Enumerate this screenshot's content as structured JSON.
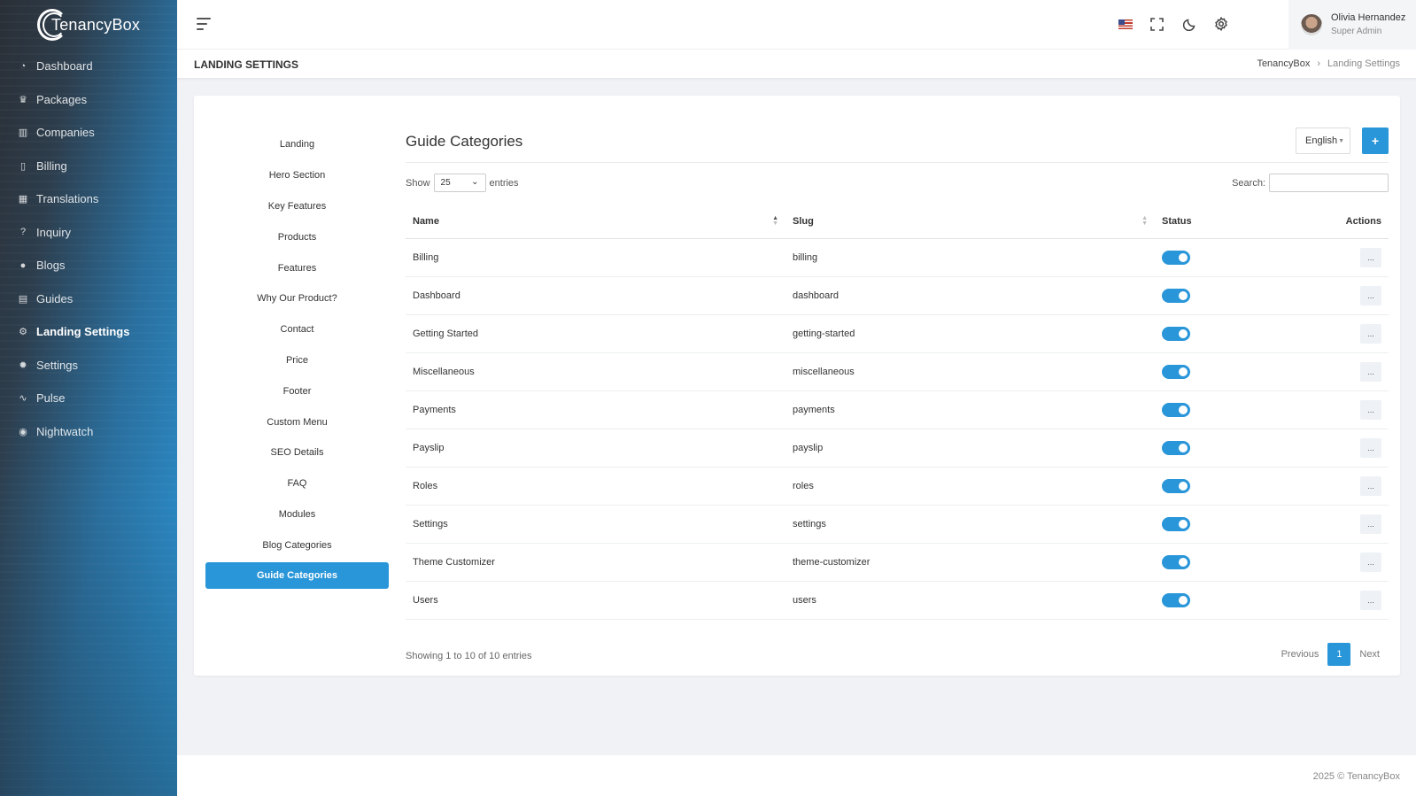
{
  "brand": {
    "name": "TenancyBox"
  },
  "sidebar": {
    "items": [
      {
        "label": "Dashboard",
        "icon": "dashboard-icon",
        "glyph": "◔"
      },
      {
        "label": "Packages",
        "icon": "trophy-icon",
        "glyph": "♛"
      },
      {
        "label": "Companies",
        "icon": "bar-chart-icon",
        "glyph": "▥"
      },
      {
        "label": "Billing",
        "icon": "document-icon",
        "glyph": "▯"
      },
      {
        "label": "Translations",
        "icon": "translate-icon",
        "glyph": "▦"
      },
      {
        "label": "Inquiry",
        "icon": "question-icon",
        "glyph": "?"
      },
      {
        "label": "Blogs",
        "icon": "blog-icon",
        "glyph": "●"
      },
      {
        "label": "Guides",
        "icon": "guide-icon",
        "glyph": "▤"
      },
      {
        "label": "Landing Settings",
        "icon": "gears-icon",
        "glyph": "⚙"
      },
      {
        "label": "Settings",
        "icon": "settings-icon",
        "glyph": "✹"
      },
      {
        "label": "Pulse",
        "icon": "pulse-icon",
        "glyph": "∿"
      },
      {
        "label": "Nightwatch",
        "icon": "eye-icon",
        "glyph": "◉"
      }
    ],
    "active_index": 8
  },
  "topbar": {
    "user_name": "Olivia Hernandez",
    "user_role": "Super Admin"
  },
  "page": {
    "title": "LANDING SETTINGS",
    "breadcrumb": [
      "TenancyBox",
      "Landing Settings"
    ]
  },
  "settings_menu": [
    "Landing",
    "Hero Section",
    "Key Features",
    "Products",
    "Features",
    "Why Our Product?",
    "Contact",
    "Price",
    "Footer",
    "Custom Menu",
    "SEO Details",
    "FAQ",
    "Modules",
    "Blog Categories",
    "Guide Categories"
  ],
  "settings_menu_active": "Guide Categories",
  "content": {
    "title": "Guide Categories",
    "language": "English",
    "add_label": "+",
    "show_label": "Show",
    "entries_value": "25",
    "entries_label": "entries",
    "search_label": "Search:",
    "search_value": ""
  },
  "table": {
    "columns": [
      "Name",
      "Slug",
      "Status",
      "Actions"
    ],
    "rows": [
      {
        "name": "Billing",
        "slug": "billing",
        "status": true
      },
      {
        "name": "Dashboard",
        "slug": "dashboard",
        "status": true
      },
      {
        "name": "Getting Started",
        "slug": "getting-started",
        "status": true
      },
      {
        "name": "Miscellaneous",
        "slug": "miscellaneous",
        "status": true
      },
      {
        "name": "Payments",
        "slug": "payments",
        "status": true
      },
      {
        "name": "Payslip",
        "slug": "payslip",
        "status": true
      },
      {
        "name": "Roles",
        "slug": "roles",
        "status": true
      },
      {
        "name": "Settings",
        "slug": "settings",
        "status": true
      },
      {
        "name": "Theme Customizer",
        "slug": "theme-customizer",
        "status": true
      },
      {
        "name": "Users",
        "slug": "users",
        "status": true
      }
    ],
    "action_label": "..."
  },
  "pagination": {
    "info": "Showing 1 to 10 of 10 entries",
    "previous": "Previous",
    "current": "1",
    "next": "Next"
  },
  "footer": {
    "text": "2025 © TenancyBox"
  },
  "colors": {
    "accent": "#2996d9",
    "sidebar_dark": "#2a2f36"
  }
}
